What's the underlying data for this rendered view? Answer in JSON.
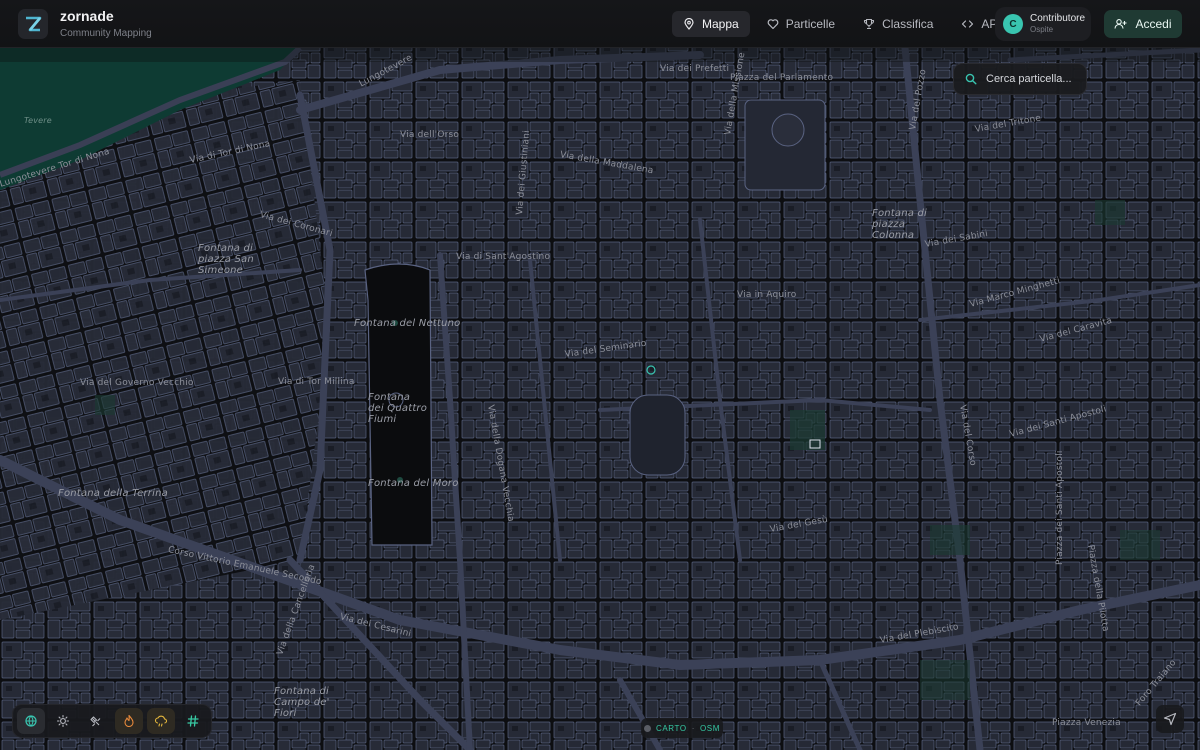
{
  "app": {
    "name": "zornade",
    "subtitle": "Community Mapping"
  },
  "nav": [
    {
      "label": "Mappa",
      "icon": "map-pin-icon",
      "active": true
    },
    {
      "label": "Particelle",
      "icon": "heart-icon",
      "active": false
    },
    {
      "label": "Classifica",
      "icon": "trophy-icon",
      "active": false
    },
    {
      "label": "API",
      "icon": "code-icon",
      "active": false
    }
  ],
  "user": {
    "initial": "C",
    "name": "Contributore",
    "role": "Ospite"
  },
  "login": {
    "label": "Accedi"
  },
  "search": {
    "label": "Cerca particella..."
  },
  "map": {
    "labels": {
      "tevere": "Tevere",
      "lungotevere": "Lungotevere Tor di Nona",
      "lungotevere_2": "Lungotevere",
      "via_prefetti": "Via dei Prefetti",
      "piazza_parlamento": "Piazza del Parlamento",
      "via_orso": "Via dell'Orso",
      "via_tor_nona": "Via di Tor di Nona",
      "via_maddalena": "Via della Maddalena",
      "via_missione": "Via della Missione",
      "via_giustiniani": "Via dei Giustiniani",
      "via_tritone": "Via del Tritone",
      "via_pozzo": "Via del Pozzo",
      "fontana_colonna": "Fontana di piazza Colonna",
      "via_sabini": "Via dei Sabini",
      "fontana_sansimeone": "Fontana di piazza San Simeone",
      "fontana_nettuno": "Fontana del Nettuno",
      "via_sant_agostino": "Via di Sant'Agostino",
      "via_coronari": "Via dei Coronari",
      "via_in_aquiro": "Via in Aquiro",
      "via_marco_minghetti": "Via Marco Minghetti",
      "via_caravita": "Via del Caravita",
      "via_seminario": "Via del Seminario",
      "via_dogana_vecchia": "Via della Dogana Vecchia",
      "via_governo_vecchio": "Via del Governo Vecchio",
      "via_tor_millina": "Via di Tor Millina",
      "fontana_quattro_fiumi": "Fontana dei Quattro Fiumi",
      "fontana_moro": "Fontana del Moro",
      "via_santi_apostoli": "Via dei Santi Apostoli",
      "fontana_terrina": "Fontana della Terrina",
      "corso_vittorio": "Corso Vittorio Emanuele Secondo",
      "via_cancelleria": "Via della Cancelleria",
      "fontana_campo": "Fontana di Campo de' Fiori",
      "via_plebiscito": "Via del Plebiscito",
      "piazza_santi_apostoli": "Piazza dei Santi Apostoli",
      "piazza_venezia": "Piazza Venezia",
      "foro_traiano": "Foro Traiano",
      "via_gesu": "Via del Gesù",
      "via_corso": "Via del Corso",
      "piazza_pilotta": "Piazza della Pilotta",
      "via_cesarini": "Via dei Cesarini"
    }
  },
  "toolbar": {
    "tools": [
      {
        "icon": "layers-globe-icon",
        "active": true
      },
      {
        "icon": "sun-icon",
        "active": false
      },
      {
        "icon": "satellite-icon",
        "active": false
      },
      {
        "icon": "flame-icon",
        "active": false,
        "color": "#e98a3c"
      },
      {
        "icon": "cloud-drizzle-icon",
        "active": false,
        "color": "#e6b83d"
      },
      {
        "icon": "hash-icon",
        "active": false,
        "color": "#38c9a4"
      }
    ]
  },
  "attribution": {
    "left": "CARTO",
    "separator": "·",
    "right": "OSM"
  },
  "colors": {
    "accent": "#39c5b0",
    "building": "#262a36",
    "building_stroke": "#5a6382",
    "road": "#3a3f55",
    "water": "#0e3b33"
  }
}
